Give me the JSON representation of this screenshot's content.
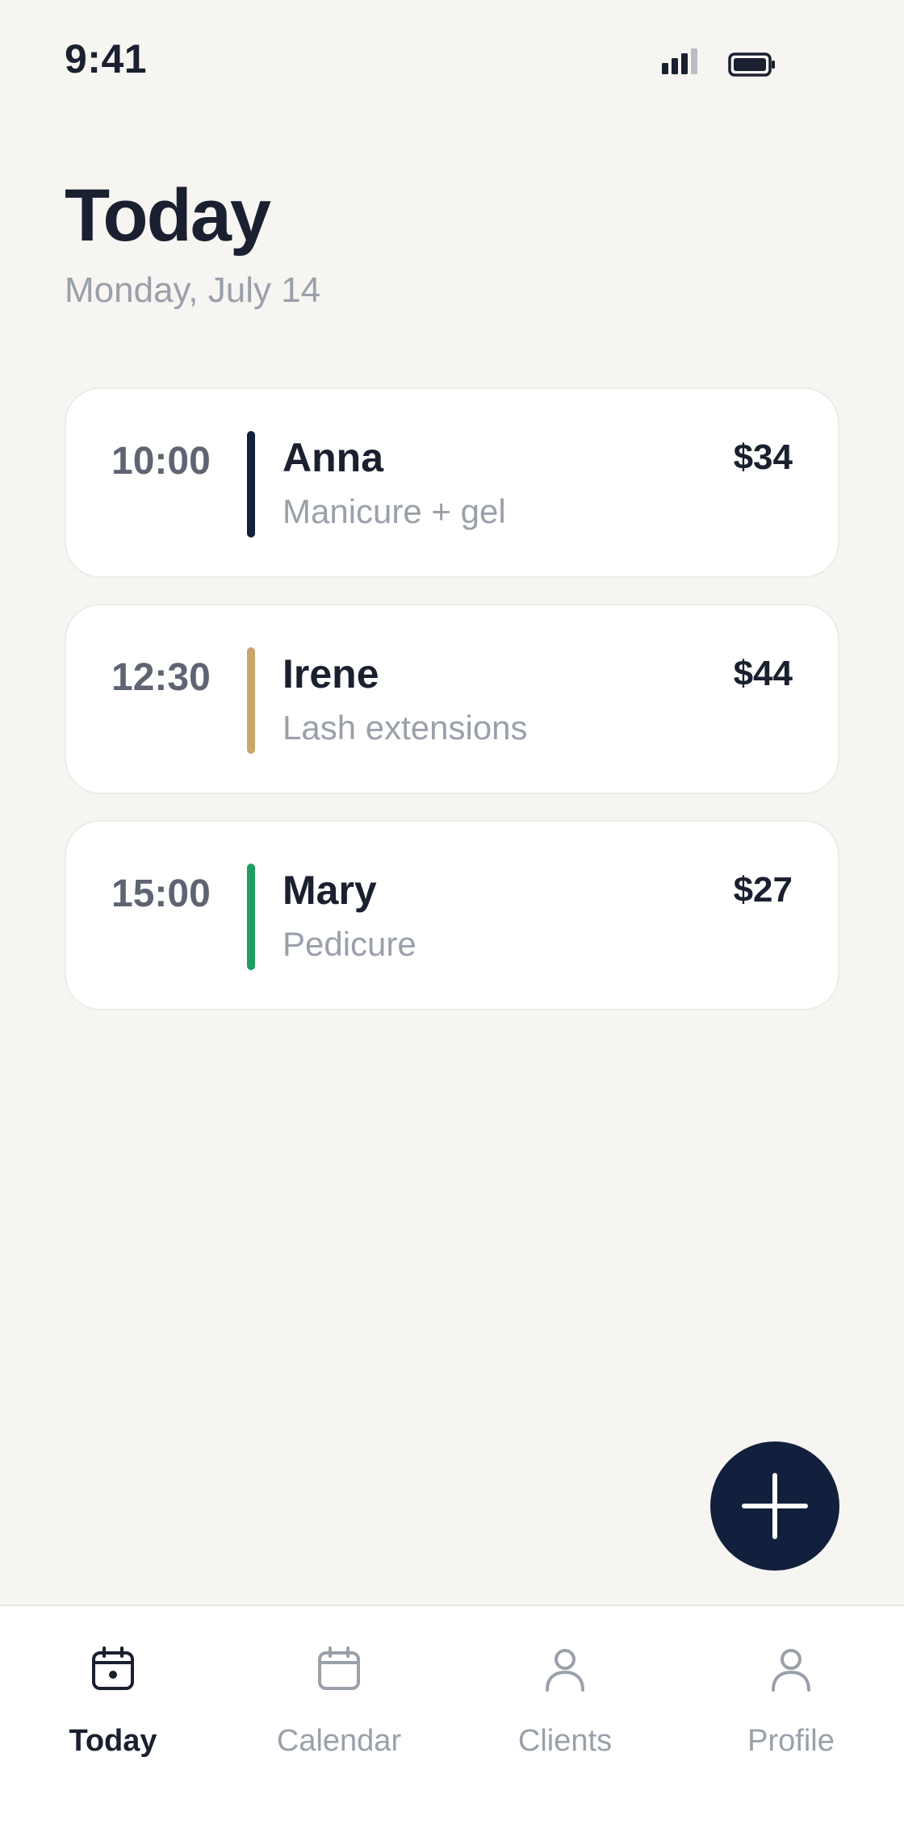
{
  "status_bar": {
    "time": "9:41",
    "signal_icon": "cellular-signal-icon",
    "battery_icon": "battery-icon"
  },
  "header": {
    "title": "Today",
    "date": "Monday, July 14"
  },
  "appointments": [
    {
      "time": "10:00",
      "name": "Anna",
      "service": "Manicure + gel",
      "price": "$34",
      "accent": "#121f3d"
    },
    {
      "time": "12:30",
      "name": "Irene",
      "service": "Lash extensions",
      "price": "$44",
      "accent": "#c9a66b"
    },
    {
      "time": "15:00",
      "name": "Mary",
      "service": "Pedicure",
      "price": "$27",
      "accent": "#1f9e63"
    }
  ],
  "fab": {
    "icon": "plus-icon",
    "color": "#121f3d"
  },
  "tab_bar": {
    "items": [
      {
        "label": "Today",
        "icon": "calendar-today-icon",
        "active": true
      },
      {
        "label": "Calendar",
        "icon": "calendar-icon",
        "active": false
      },
      {
        "label": "Clients",
        "icon": "person-icon",
        "active": false
      },
      {
        "label": "Profile",
        "icon": "person-icon",
        "active": false
      }
    ]
  },
  "colors": {
    "background": "#f6f5f2",
    "text_primary": "#1b2030",
    "text_secondary": "#9aa0aa",
    "accent_navy": "#121f3d"
  }
}
